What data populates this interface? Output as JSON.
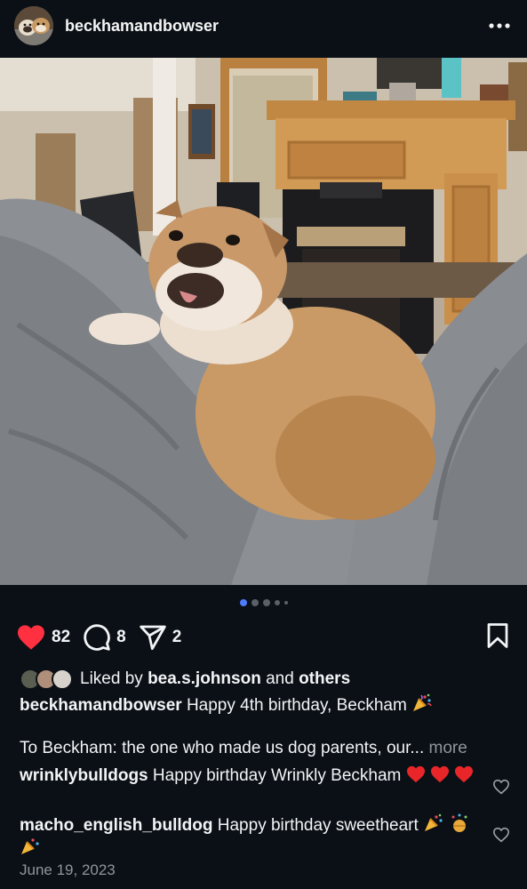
{
  "post": {
    "username": "beckhamandbowser",
    "avatar_icon": "avatar-bulldogs",
    "more_icon": "more-horizontal-icon",
    "image_description_icon": "bulldog-photo",
    "carousel": {
      "count": 5,
      "active": 0
    }
  },
  "actions": {
    "likes": "82",
    "comments": "8",
    "shares": "2",
    "like_icon": "heart-filled-icon",
    "comment_icon": "comment-icon",
    "share_icon": "send-icon",
    "save_icon": "bookmark-icon",
    "like_color": "#ff3040"
  },
  "liked_by": {
    "prefix": "Liked by",
    "user": "bea.s.johnson",
    "conjunction": "and",
    "others": "others"
  },
  "caption": {
    "username": "beckhamandbowser",
    "text": "Happy 4th birthday, Beckham",
    "text2": "To Beckham: the one who made us dog parents, our...",
    "more": "more"
  },
  "comments": [
    {
      "username": "wrinklybulldogs",
      "text": "Happy birthday Wrinkly Beckham"
    },
    {
      "username": "macho_english_bulldog",
      "text": "Happy birthday sweetheart"
    }
  ],
  "date": "June 19, 2023"
}
